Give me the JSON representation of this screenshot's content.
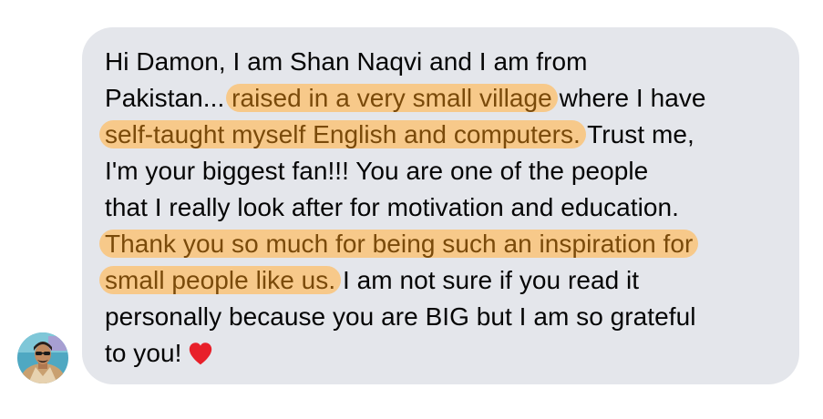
{
  "message": {
    "lines": [
      [
        {
          "t": "Hi Damon, I am Shan Naqvi and I am from",
          "h": false
        }
      ],
      [
        {
          "t": "Pakistan... ",
          "h": false
        },
        {
          "t": "raised in a very small village",
          "h": true
        },
        {
          "t": " where I have",
          "h": false
        }
      ],
      [
        {
          "t": "self-taught myself English and computers.",
          "h": true
        },
        {
          "t": " Trust me,",
          "h": false
        }
      ],
      [
        {
          "t": "I'm your biggest fan!!! You are one of the people",
          "h": false
        }
      ],
      [
        {
          "t": "that I really look after for motivation and education.",
          "h": false
        }
      ],
      [
        {
          "t": "Thank you so much for being such an inspiration for",
          "h": true
        }
      ],
      [
        {
          "t": "small people like us.",
          "h": true
        },
        {
          "t": " I am not sure if you read it",
          "h": false
        }
      ],
      [
        {
          "t": "personally because you are BIG but I am so grateful",
          "h": false
        }
      ],
      [
        {
          "t": "to you!",
          "h": false
        }
      ]
    ],
    "emoji": "heart-emoji"
  },
  "colors": {
    "bubble": "#e4e6eb",
    "highlight": "#f7c98a",
    "highlight_text": "#7a4a0a",
    "text": "#050505",
    "heart": "#e8202a"
  },
  "sender": {
    "avatar_icon": "profile-avatar"
  }
}
